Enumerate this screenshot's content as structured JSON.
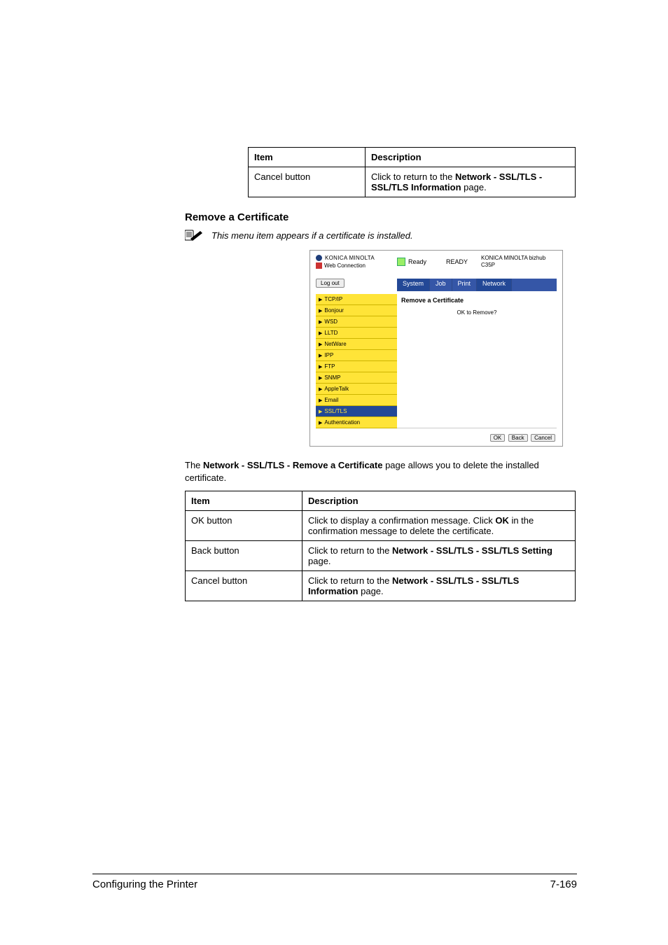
{
  "table1": {
    "headers": {
      "item": "Item",
      "desc": "Description"
    },
    "rows": [
      {
        "item": "Cancel button",
        "desc_pre": "Click to return to the ",
        "desc_bold": "Network - SSL/TLS - SSL/TLS Information",
        "desc_post": " page."
      }
    ]
  },
  "heading": "Remove a Certificate",
  "note": "This menu item appears if a certificate is installed.",
  "screenshot": {
    "brand": "KONICA MINOLTA",
    "webcon": "Web Connection",
    "ready_label": "Ready",
    "status_text": "READY",
    "device_line1": "KONICA MINOLTA bizhub",
    "device_line2": "C35P",
    "logout": "Log out",
    "tabs": [
      "System",
      "Job",
      "Print",
      "Network"
    ],
    "sidebar": [
      "TCP/IP",
      "Bonjour",
      "WSD",
      "LLTD",
      "NetWare",
      "IPP",
      "FTP",
      "SNMP",
      "AppleTalk",
      "Email",
      "SSL/TLS",
      "Authentication"
    ],
    "selected_sidebar_index": 10,
    "content_title": "Remove a Certificate",
    "content_msg": "OK to Remove?",
    "buttons": {
      "ok": "OK",
      "back": "Back",
      "cancel": "Cancel"
    }
  },
  "paragraph": {
    "pre": "The ",
    "bold": "Network - SSL/TLS - Remove a Certificate",
    "post": " page allows you to delete the installed certificate."
  },
  "table2": {
    "headers": {
      "item": "Item",
      "desc": "Description"
    },
    "rows": [
      {
        "item": "OK button",
        "desc_pre": "Click to display a confirmation message. Click ",
        "desc_bold": "OK",
        "desc_post": " in the confirmation message to delete the certificate."
      },
      {
        "item": "Back button",
        "desc_pre": "Click to return to the ",
        "desc_bold": "Network - SSL/TLS - SSL/TLS Setting",
        "desc_post": " page."
      },
      {
        "item": "Cancel button",
        "desc_pre": "Click to return to the ",
        "desc_bold": "Network - SSL/TLS - SSL/TLS Information",
        "desc_post": " page."
      }
    ]
  },
  "footer": {
    "left": "Configuring the Printer",
    "right": "7-169"
  }
}
